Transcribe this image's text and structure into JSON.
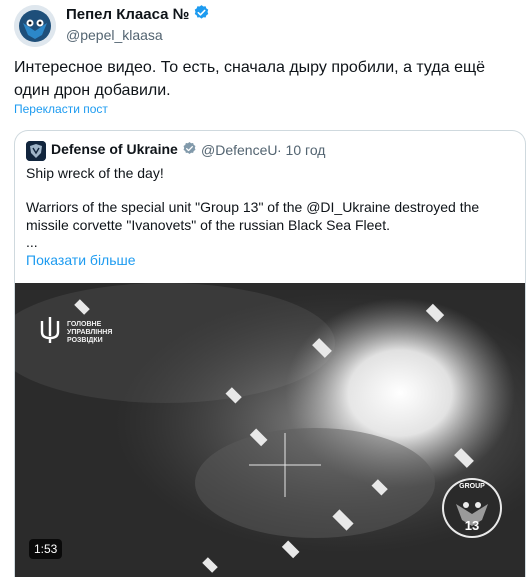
{
  "author": {
    "name": "Пепел Клааса №",
    "handle": "@pepel_klaasa"
  },
  "tweet": {
    "text": "Интересное видео. То есть, сначала дыру пробили, а туда ещё один дрон добавили.",
    "translate_label": "Перекласти пост"
  },
  "quote": {
    "name": "Defense of Ukraine",
    "handle": "@DefenceU",
    "time": "· 10 год",
    "line1": "Ship wreck of the day!",
    "line2": "Warriors of the special unit \"Group 13\" of the @DI_Ukraine destroyed the",
    "line3": "missile corvette \"Ivanovets\" of the russian Black Sea Fleet.",
    "line4": "...",
    "show_more": "Показати більше",
    "video": {
      "duration": "1:53",
      "watermark_line1": "ГОЛОВНЕ",
      "watermark_line2": "УПРАВЛІННЯ",
      "watermark_line3": "РОЗВІДКИ",
      "badge_top": "GROUP",
      "badge_number": "13"
    }
  },
  "colors": {
    "accent": "#1d9bf0",
    "text": "#0f1419",
    "muted": "#536471",
    "border": "#cfd9de"
  }
}
